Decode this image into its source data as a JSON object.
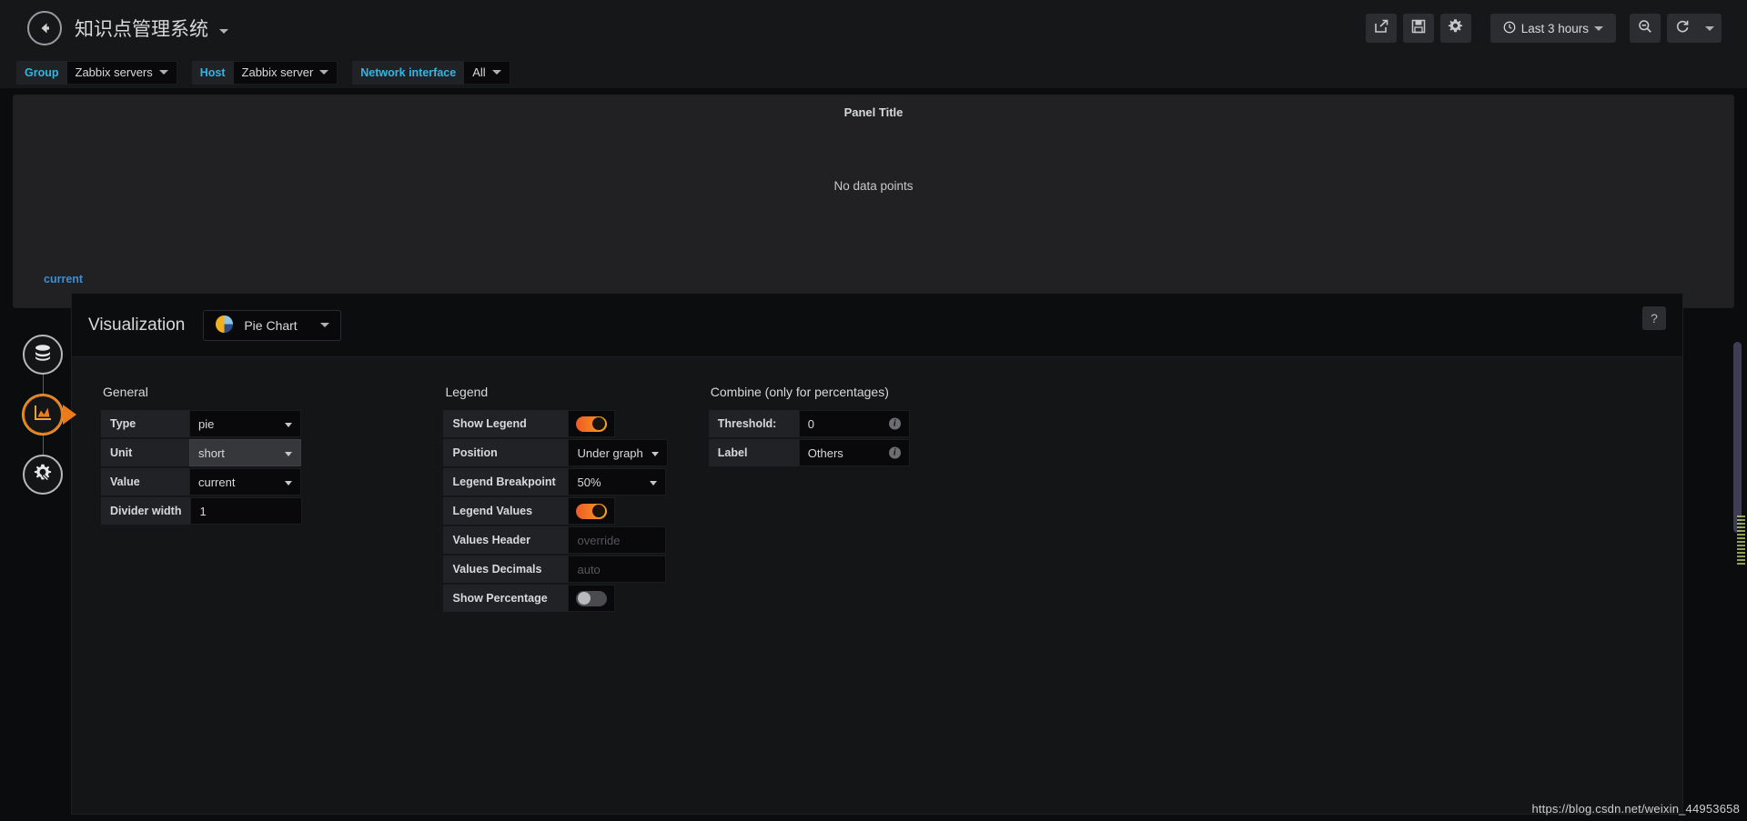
{
  "navbar": {
    "back_icon": "arrow-left-circle-icon",
    "dashboard_title": "知识点管理系统",
    "buttons": [
      {
        "name": "share-dashboard-button",
        "icon": "share-icon"
      },
      {
        "name": "save-dashboard-button",
        "icon": "floppy-save-icon"
      },
      {
        "name": "dashboard-settings-button",
        "icon": "gear-icon"
      }
    ],
    "time_picker": {
      "icon": "clock-icon",
      "label": "Last 3 hours"
    },
    "zoom_out": {
      "name": "zoom-out-button",
      "icon": "magnifier-minus-icon"
    },
    "refresh": {
      "name": "refresh-button",
      "icon": "refresh-icon"
    }
  },
  "template_variables": [
    {
      "label": "Group",
      "value": "Zabbix servers"
    },
    {
      "label": "Host",
      "value": "Zabbix server"
    },
    {
      "label": "Network interface",
      "value": "All"
    }
  ],
  "panel_preview": {
    "title": "Panel Title",
    "no_data": "No data points",
    "legend_series": "current"
  },
  "edit_sidebar": [
    {
      "name": "tab-queries",
      "icon": "database-icon",
      "active": false
    },
    {
      "name": "tab-visualization",
      "icon": "graph-area-icon",
      "active": true
    },
    {
      "name": "tab-general",
      "icon": "gear-wrench-icon",
      "active": false
    }
  ],
  "visualization": {
    "header_label": "Visualization",
    "selected_type": "Pie Chart",
    "type_icon": "pie-chart-icon",
    "help_label": "?"
  },
  "options": {
    "general": {
      "title": "General",
      "rows": [
        {
          "key": "Type",
          "value": "pie",
          "control": "select"
        },
        {
          "key": "Unit",
          "value": "short",
          "control": "select",
          "highlighted": true
        },
        {
          "key": "Value",
          "value": "current",
          "control": "select"
        },
        {
          "key": "Divider width",
          "value": "1",
          "control": "input"
        }
      ]
    },
    "legend": {
      "title": "Legend",
      "rows": [
        {
          "key": "Show Legend",
          "control": "toggle",
          "value": "on"
        },
        {
          "key": "Position",
          "value": "Under graph",
          "control": "select"
        },
        {
          "key": "Legend Breakpoint",
          "value": "50%",
          "control": "select"
        },
        {
          "key": "Legend Values",
          "control": "toggle",
          "value": "on"
        },
        {
          "key": "Values Header",
          "value": "",
          "placeholder": "override",
          "control": "input"
        },
        {
          "key": "Values Decimals",
          "value": "",
          "placeholder": "auto",
          "control": "input"
        },
        {
          "key": "Show Percentage",
          "control": "toggle",
          "value": "off"
        }
      ]
    },
    "combine": {
      "title": "Combine (only for percentages)",
      "rows": [
        {
          "key": "Threshold:",
          "value": "0",
          "control": "input",
          "info": true
        },
        {
          "key": "Label",
          "value": "Others",
          "control": "input",
          "info": true
        }
      ]
    }
  },
  "watermark": "https://blog.csdn.net/weixin_44953658"
}
